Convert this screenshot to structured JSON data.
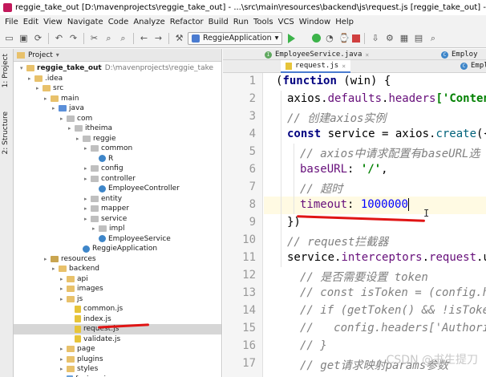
{
  "window_title": "reggie_take_out [D:\\mavenprojects\\reggie_take_out] - ...\\src\\main\\resources\\backend\\js\\request.js [reggie_take_out] - IntelliJ IDEA",
  "menu": [
    "File",
    "Edit",
    "View",
    "Navigate",
    "Code",
    "Analyze",
    "Refactor",
    "Build",
    "Run",
    "Tools",
    "VCS",
    "Window",
    "Help"
  ],
  "toolbar": {
    "run_config": "ReggieApplication",
    "icons": [
      "open-icon",
      "save-icon",
      "sync-icon",
      "back-icon",
      "forward-icon",
      "build-icon",
      "find-icon",
      "replace-icon",
      "structure-icon",
      "navigate-icon",
      "run-icon",
      "debug-icon",
      "coverage-icon",
      "stop-icon",
      "vcs-icon",
      "settings-icon",
      "project-structure-icon",
      "search-everywhere-icon"
    ]
  },
  "side_tabs": [
    "1: Project",
    "2: Structure"
  ],
  "project_panel": {
    "header": "Project",
    "root_name": "reggie_take_out",
    "root_path": "D:\\mavenprojects\\reggie_take",
    "tree": [
      {
        "label": ".idea",
        "type": "folder"
      },
      {
        "label": "src",
        "type": "folder"
      },
      {
        "label": "main",
        "type": "folder"
      },
      {
        "label": "java",
        "type": "folder-src"
      },
      {
        "label": "com",
        "type": "package"
      },
      {
        "label": "itheima",
        "type": "package"
      },
      {
        "label": "reggie",
        "type": "package"
      },
      {
        "label": "common",
        "type": "package"
      },
      {
        "label": "R",
        "type": "class"
      },
      {
        "label": "config",
        "type": "package"
      },
      {
        "label": "controller",
        "type": "package"
      },
      {
        "label": "EmployeeController",
        "type": "class"
      },
      {
        "label": "entity",
        "type": "package"
      },
      {
        "label": "mapper",
        "type": "package"
      },
      {
        "label": "service",
        "type": "package"
      },
      {
        "label": "impl",
        "type": "package"
      },
      {
        "label": "EmployeeService",
        "type": "class"
      },
      {
        "label": "ReggieApplication",
        "type": "class"
      },
      {
        "label": "resources",
        "type": "folder-res"
      },
      {
        "label": "backend",
        "type": "folder"
      },
      {
        "label": "api",
        "type": "folder"
      },
      {
        "label": "images",
        "type": "folder"
      },
      {
        "label": "js",
        "type": "folder"
      },
      {
        "label": "common.js",
        "type": "js"
      },
      {
        "label": "index.js",
        "type": "js"
      },
      {
        "label": "request.js",
        "type": "js"
      },
      {
        "label": "validate.js",
        "type": "js"
      },
      {
        "label": "page",
        "type": "folder"
      },
      {
        "label": "plugins",
        "type": "folder"
      },
      {
        "label": "styles",
        "type": "folder"
      },
      {
        "label": "favicon.ico",
        "type": "ico"
      }
    ]
  },
  "editor": {
    "tabs_row1": [
      {
        "label": "EmployeeService.java",
        "icon": "I"
      },
      {
        "label": "Employ",
        "icon": "C"
      }
    ],
    "tabs_row2": [
      {
        "label": "request.js",
        "icon": "js"
      },
      {
        "label": "Empl",
        "icon": "C"
      }
    ],
    "line_numbers": [
      "1",
      "2",
      "3",
      "4",
      "5",
      "6",
      "7",
      "8",
      "9",
      "10",
      "11",
      "12",
      "13",
      "14",
      "15",
      "16",
      "17"
    ],
    "code": {
      "l1a": "(",
      "l1b": "function",
      "l1c": " (",
      "l1d": "win",
      "l1e": ") {",
      "l2a": "axios.",
      "l2b": "defaults",
      "l2c": ".",
      "l2d": "headers",
      "l2e": "['Conten",
      "l3": "// 创建axios实例",
      "l4a": "const",
      "l4b": " service = ",
      "l4c": "axios.",
      "l4d": "create",
      "l4e": "({",
      "l5": "// axios中请求配置有baseURL选",
      "l6a": "baseURL",
      "l6b": ": ",
      "l6c": "'/'",
      "l6d": ",",
      "l7": "// 超时",
      "l8a": "timeout",
      "l8b": ": ",
      "l8c": "1000000",
      "l9": "})",
      "l10": "// request拦截器",
      "l11a": "service.",
      "l11b": "interceptors",
      "l11c": ".",
      "l11d": "request",
      "l11e": ".u",
      "l12": "// 是否需要设置 token",
      "l13": "// const isToken = (config.he",
      "l14": "// if (getToken() && !isToken",
      "l15": "//   config.headers['Authoriz",
      "l16": "// }",
      "l17": "// get请求映射params参数"
    }
  },
  "watermark": "CSDN @书生提刀",
  "accent": "#e01414"
}
